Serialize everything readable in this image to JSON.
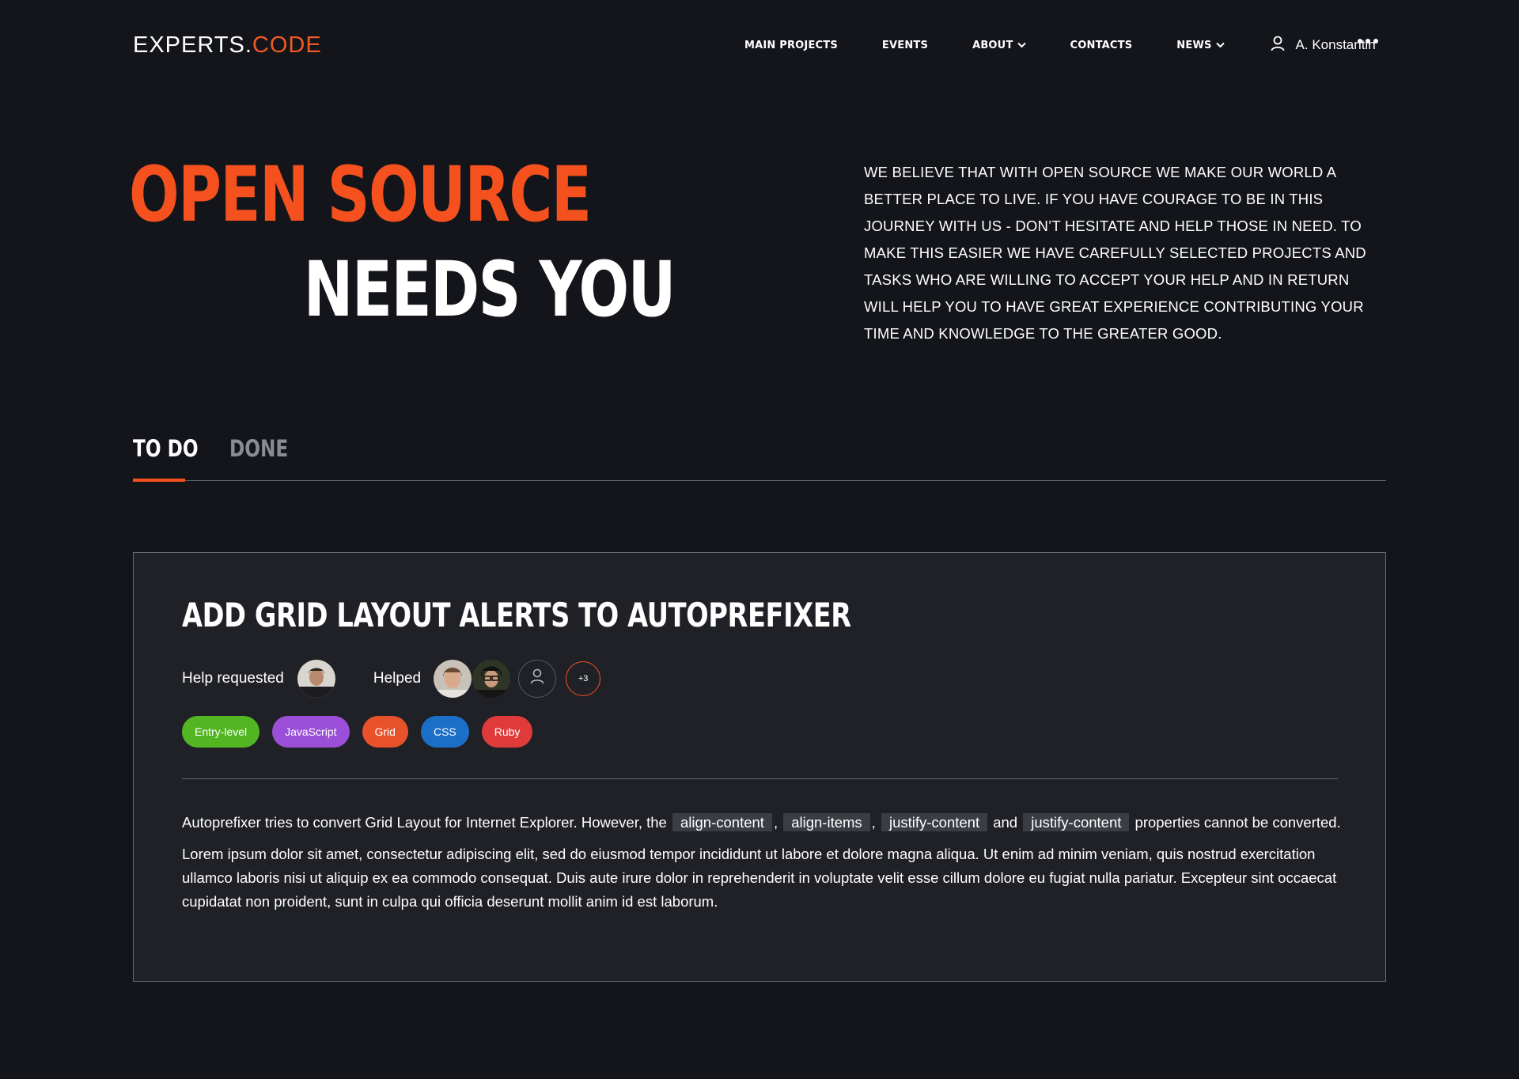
{
  "brand": {
    "part1": "EXPERTS.",
    "part2": "CODE",
    "accent": "#f15a24"
  },
  "nav": {
    "items": [
      {
        "label": "MAIN PROJECTS",
        "has_dropdown": false
      },
      {
        "label": "EVENTS",
        "has_dropdown": false
      },
      {
        "label": "ABOUT",
        "has_dropdown": true
      },
      {
        "label": "CONTACTS",
        "has_dropdown": false
      },
      {
        "label": "NEWS",
        "has_dropdown": true
      }
    ],
    "user_name": "A. Konstantin",
    "user_icon": "user-icon",
    "more_icon": "more-horizontal-icon"
  },
  "hero": {
    "line1": "OPEN SOURCE",
    "line2": "NEEDS YOU",
    "description": "We believe that with open source we make our world a better place to live. If you have courage to be in this journey with us - don’t hesitate and help those in need. To make this easier we have carefully selected projects and tasks who are willing to accept your help and in return will help you to have great experience contributing your time and knowledge to the greater good."
  },
  "tabs": [
    {
      "label": "TO DO",
      "active": true
    },
    {
      "label": "DONE",
      "active": false
    }
  ],
  "card": {
    "title": "ADD GRID LAYOUT ALERTS TO AUTOPREFIXER",
    "help_requested_label": "Help requested",
    "helped_label": "Helped",
    "helped_more": "+3",
    "tags": [
      {
        "label": "Entry-level",
        "color": "#52b623"
      },
      {
        "label": "JavaScript",
        "color": "#9b4fd9"
      },
      {
        "label": "Grid",
        "color": "#e8522a"
      },
      {
        "label": "CSS",
        "color": "#1b6fc9"
      },
      {
        "label": "Ruby",
        "color": "#e03b3b"
      }
    ],
    "desc_intro": "Autoprefixer tries to convert Grid Layout for Internet Explorer. However, the",
    "code1": "align-content",
    "sep1": ",",
    "code2": "align-items",
    "sep2": ",",
    "code3": "justify-content",
    "and": "and",
    "code4": "justify-content",
    "desc_outro": "properties cannot be converted.",
    "lorem": "Lorem ipsum dolor sit amet, consectetur adipiscing elit, sed do eiusmod tempor incididunt ut labore et dolore magna aliqua. Ut enim ad minim veniam, quis nostrud exercitation ullamco laboris nisi ut aliquip ex ea commodo consequat. Duis aute irure dolor in reprehenderit in voluptate velit esse cillum dolore eu fugiat nulla pariatur. Excepteur sint occaecat cupidatat non proident, sunt in culpa qui officia deserunt mollit anim id est laborum."
  }
}
